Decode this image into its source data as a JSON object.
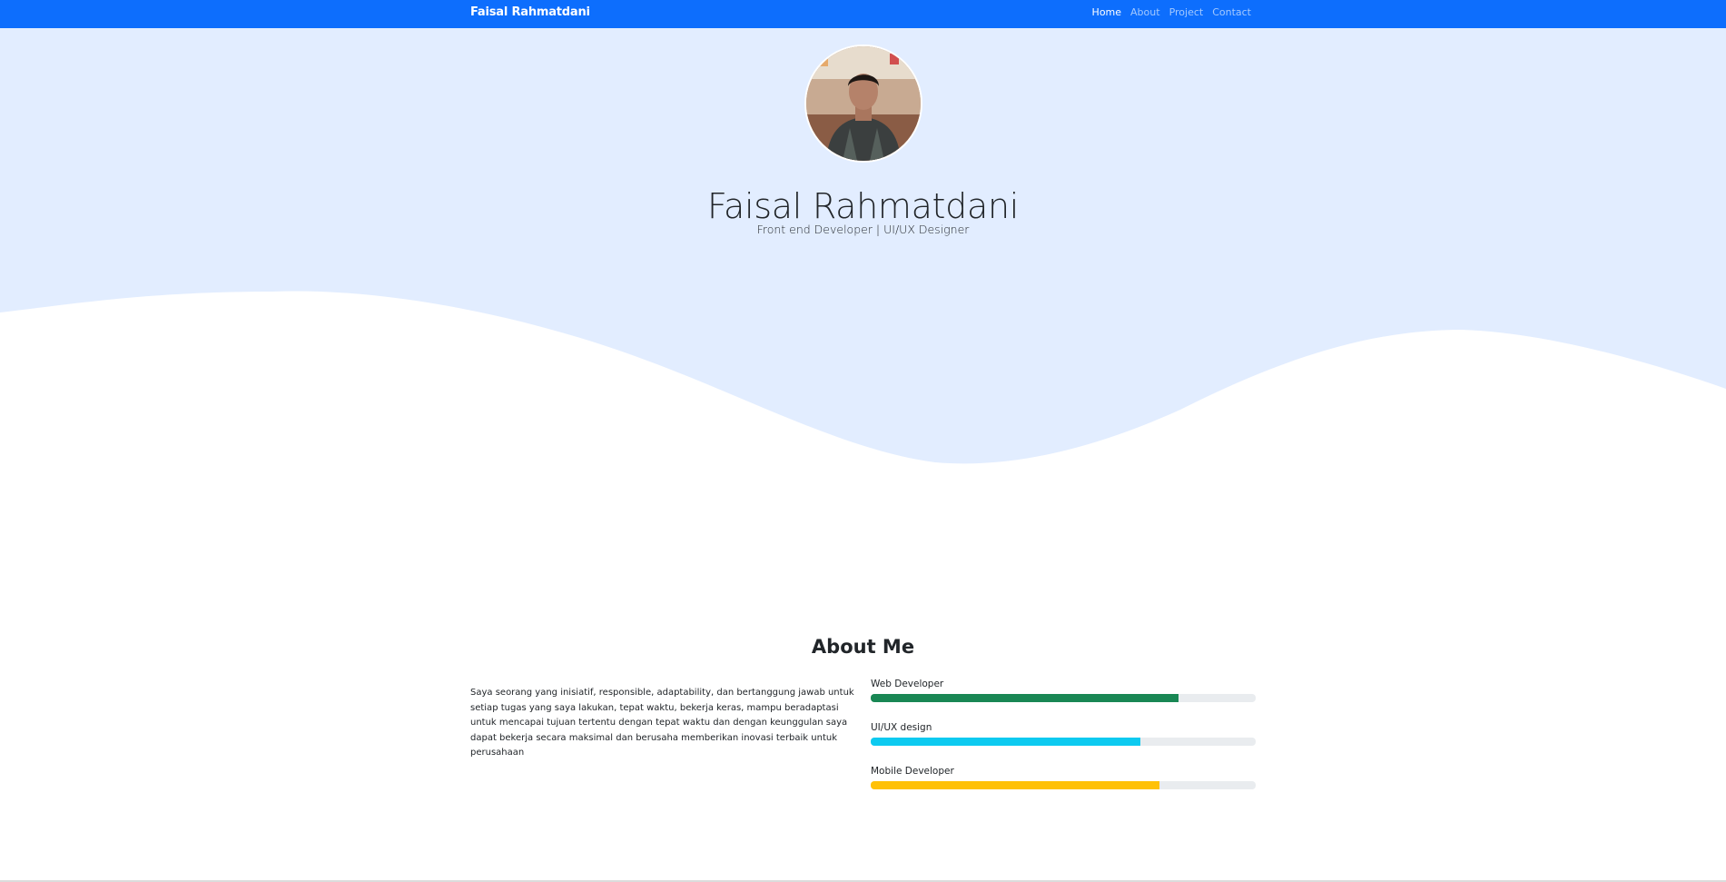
{
  "navbar": {
    "brand": "Faisal Rahmatdani",
    "links": [
      {
        "label": "Home",
        "active": true
      },
      {
        "label": "About",
        "active": false
      },
      {
        "label": "Project",
        "active": false
      },
      {
        "label": "Contact",
        "active": false
      }
    ]
  },
  "hero": {
    "name": "Faisal Rahmatdani",
    "subtitle": "Front end Developer | UI/UX Designer"
  },
  "about": {
    "title": "About Me",
    "text": "Saya seorang yang inisiatif, responsible, adaptability, dan bertanggung jawab untuk setiap tugas yang saya lakukan, tepat waktu, bekerja keras, mampu beradaptasi untuk mencapai tujuan tertentu dengan tepat waktu dan dengan keunggulan saya dapat bekerja secara maksimal dan berusaha memberikan inovasi terbaik untuk perusahaan",
    "skills": [
      {
        "label": "Web Developer",
        "percent": 80,
        "color": "#198754"
      },
      {
        "label": "UI/UX design",
        "percent": 70,
        "color": "#0dcaf0"
      },
      {
        "label": "Mobile Developer",
        "percent": 75,
        "color": "#ffc107"
      }
    ]
  },
  "colors": {
    "primary": "#0d6efd",
    "hero_background": "#e2edff",
    "progress_track": "#e9ecef"
  }
}
